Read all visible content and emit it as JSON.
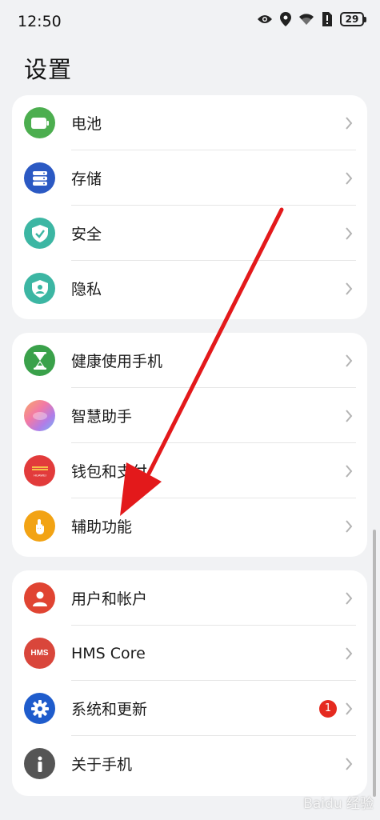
{
  "status_bar": {
    "time": "12:50",
    "battery": "29"
  },
  "page_title": "设置",
  "groups": [
    {
      "items": [
        {
          "label": "电池",
          "icon": "battery-icon",
          "color": "#4cae4f"
        },
        {
          "label": "存储",
          "icon": "storage-icon",
          "color": "#2b59c3"
        },
        {
          "label": "安全",
          "icon": "shield-check-icon",
          "color": "#3cb6a3"
        },
        {
          "label": "隐私",
          "icon": "privacy-icon",
          "color": "#3cb6a3"
        }
      ]
    },
    {
      "items": [
        {
          "label": "健康使用手机",
          "icon": "hourglass-icon",
          "color": "#3aa14a"
        },
        {
          "label": "智慧助手",
          "icon": "celia-icon",
          "color": "#f08aa8"
        },
        {
          "label": "钱包和支付",
          "icon": "wallet-icon",
          "color": "#e23b3b",
          "icon_text": "HUAWEI"
        },
        {
          "label": "辅助功能",
          "icon": "hand-tap-icon",
          "color": "#f2a314"
        }
      ]
    },
    {
      "items": [
        {
          "label": "用户和帐户",
          "icon": "user-icon",
          "color": "#e04432"
        },
        {
          "label": "HMS Core",
          "icon": "hms-icon",
          "color": "#d9463b",
          "icon_text": "HMS"
        },
        {
          "label": "系统和更新",
          "icon": "gear-icon",
          "color": "#1f5ccc",
          "badge": "1"
        },
        {
          "label": "关于手机",
          "icon": "info-icon",
          "color": "#555555"
        }
      ]
    }
  ],
  "watermark": "Baidu 经验",
  "colors": {
    "background": "#f1f2f4",
    "card": "#ffffff",
    "annotation_arrow": "#e3191b",
    "badge": "#e52a1f"
  }
}
